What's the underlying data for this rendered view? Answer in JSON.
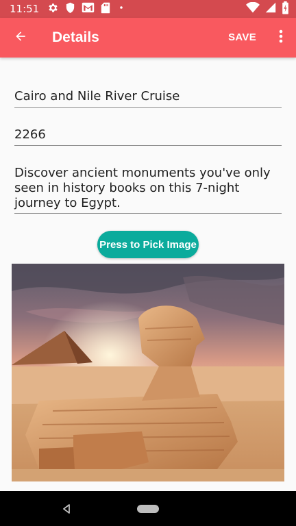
{
  "status_bar": {
    "time": "11:51",
    "icons": [
      "gear-icon",
      "shield-icon",
      "gmail-icon",
      "sd-card-icon",
      "dot-icon",
      "wifi-icon",
      "signal-icon",
      "battery-icon"
    ]
  },
  "app_bar": {
    "title": "Details",
    "save_label": "SAVE",
    "color": "#f9595f"
  },
  "form": {
    "title_value": "Cairo and Nile River Cruise",
    "price_value": "2266",
    "description_value": "Discover ancient monuments you've only seen in history books on this 7-night journey to Egypt."
  },
  "pick_image_label": "Press to Pick Image",
  "accent_color": "#0bab9c",
  "image": {
    "subject": "sphinx-and-pyramid-icon"
  }
}
